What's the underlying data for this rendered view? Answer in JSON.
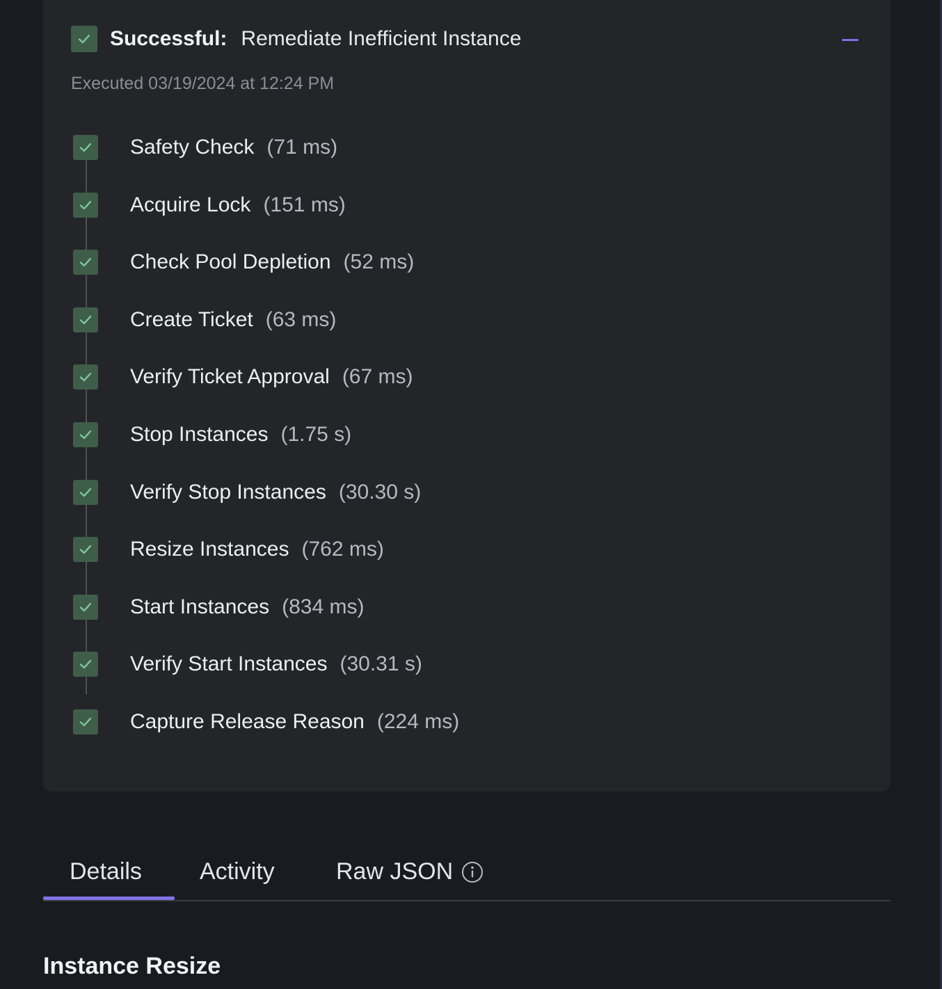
{
  "run": {
    "status_label": "Successful:",
    "action_title": "Remediate Inefficient Instance",
    "executed": "Executed 03/19/2024 at 12:24 PM"
  },
  "steps": [
    {
      "name": "Safety Check",
      "duration": "(71 ms)"
    },
    {
      "name": "Acquire Lock",
      "duration": "(151 ms)"
    },
    {
      "name": "Check Pool Depletion",
      "duration": "(52 ms)"
    },
    {
      "name": "Create Ticket",
      "duration": "(63 ms)"
    },
    {
      "name": "Verify Ticket Approval",
      "duration": "(67 ms)"
    },
    {
      "name": "Stop Instances",
      "duration": "(1.75 s)"
    },
    {
      "name": "Verify Stop Instances",
      "duration": "(30.30 s)"
    },
    {
      "name": "Resize Instances",
      "duration": "(762 ms)"
    },
    {
      "name": "Start Instances",
      "duration": "(834 ms)"
    },
    {
      "name": "Verify Start Instances",
      "duration": "(30.31 s)"
    },
    {
      "name": "Capture Release Reason",
      "duration": "(224 ms)"
    }
  ],
  "tabs": [
    {
      "label": "Details",
      "active": true
    },
    {
      "label": "Activity",
      "active": false
    },
    {
      "label": "Raw JSON",
      "active": false,
      "icon": "info-icon"
    }
  ],
  "section": {
    "title": "Instance Resize"
  },
  "colors": {
    "background": "#1a1b21",
    "card": "#242529",
    "check_fill": "#3f5e49",
    "check_mark": "#7fc79a",
    "accent": "#8473e8"
  },
  "icons": {
    "step_status": "check-icon",
    "collapse": "minus-icon",
    "raw_json_info": "info-icon"
  }
}
